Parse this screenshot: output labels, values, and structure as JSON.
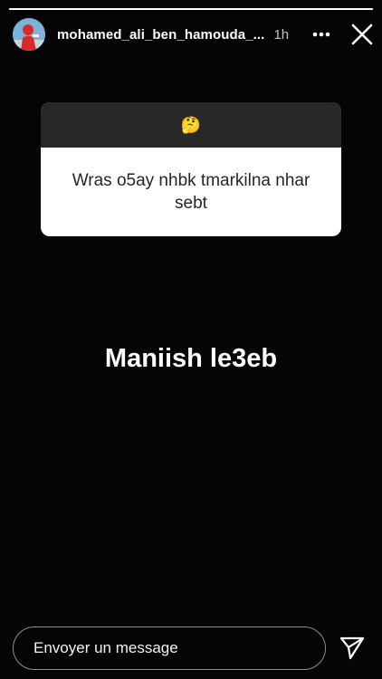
{
  "story": {
    "progress_fraction": 1.0,
    "username": "mohamed_ali_ben_hamouda_...",
    "time_ago": "1h"
  },
  "question": {
    "emoji": "🤔",
    "text": "Wras o5ay nhbk tmarkilna nhar sebt"
  },
  "answer": {
    "text": "Maniish le3eb"
  },
  "reply": {
    "placeholder": "Envoyer un message"
  },
  "icons": {
    "more": "more-horizontal-icon",
    "close": "close-icon",
    "send": "paper-plane-send-icon"
  },
  "colors": {
    "background": "#050505",
    "card_header": "#282828",
    "card_body": "#ffffff",
    "card_text": "#262626",
    "avatar_bg": "#6aa3cf",
    "avatar_figure": "#d62b2b"
  }
}
